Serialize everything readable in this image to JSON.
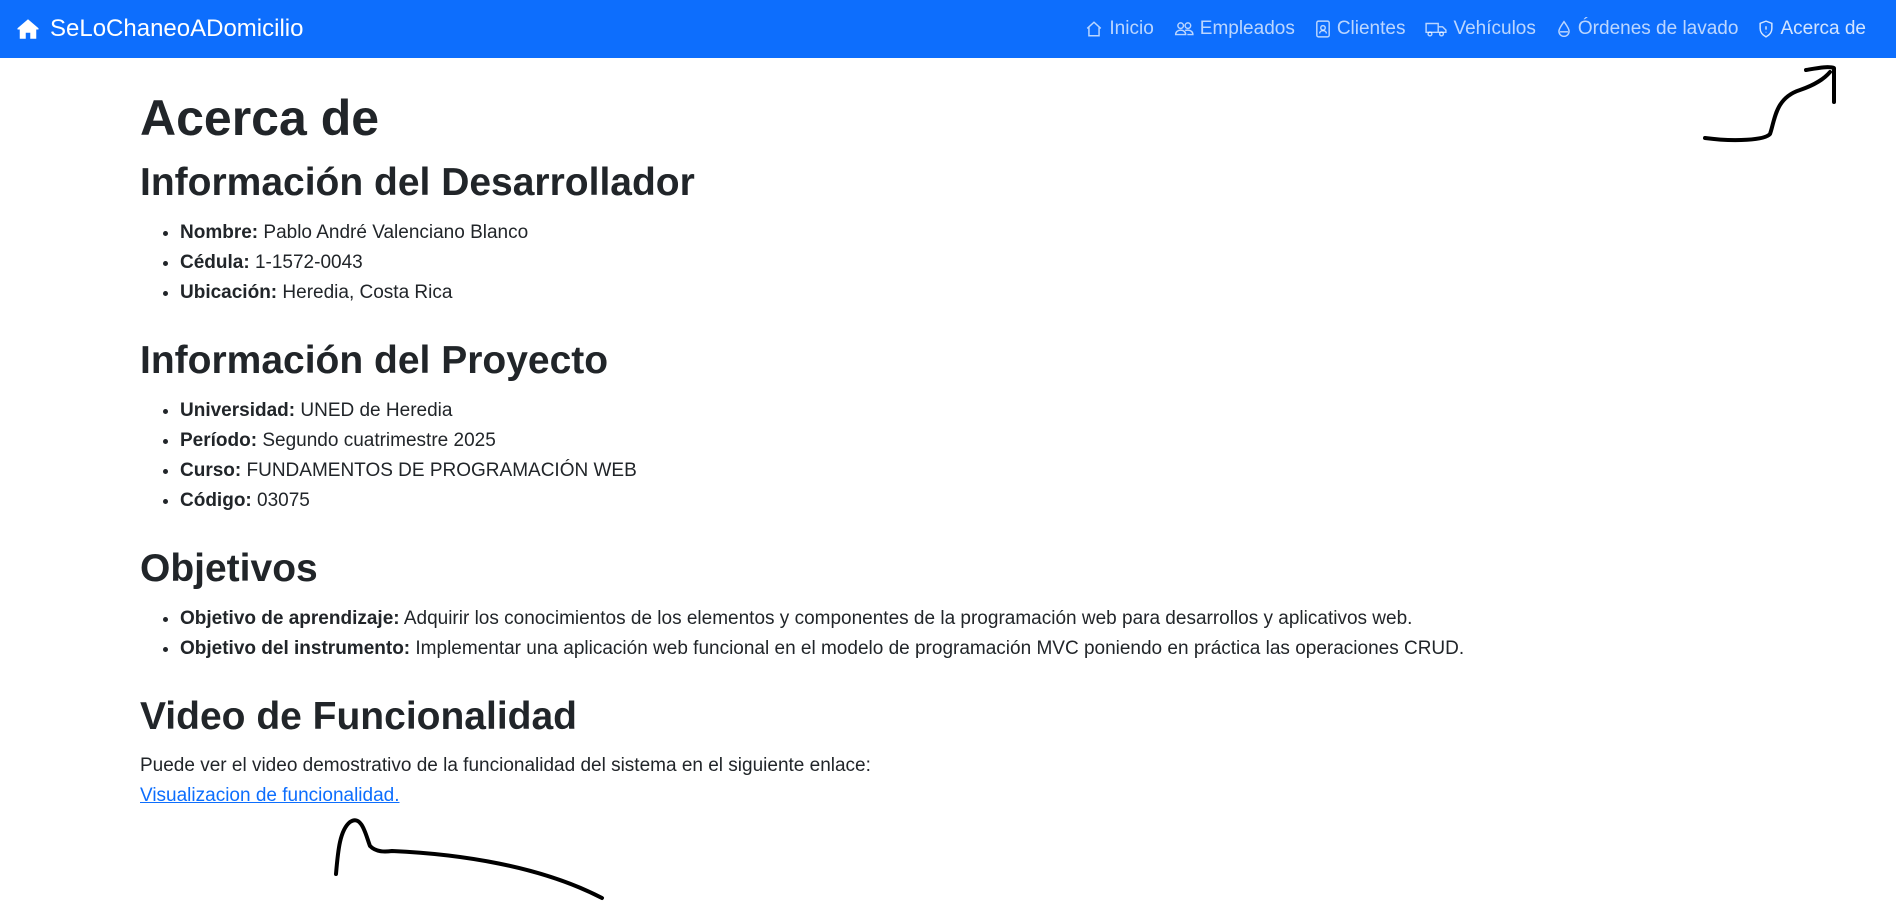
{
  "navbar": {
    "brand": "SeLoChaneoADomicilio",
    "links": [
      {
        "label": "Inicio",
        "icon": "house-icon"
      },
      {
        "label": "Empleados",
        "icon": "people-icon"
      },
      {
        "label": "Clientes",
        "icon": "person-badge-icon"
      },
      {
        "label": "Vehículos",
        "icon": "truck-icon"
      },
      {
        "label": "Órdenes de lavado",
        "icon": "droplet-icon"
      },
      {
        "label": "Acerca de",
        "icon": "shield-icon"
      }
    ],
    "bg_color": "#0d6efd"
  },
  "page": {
    "title": "Acerca de",
    "developer": {
      "heading": "Información del Desarrollador",
      "items": [
        {
          "key": "Nombre:",
          "value": " Pablo André Valenciano Blanco"
        },
        {
          "key": "Cédula:",
          "value": " 1-1572-0043"
        },
        {
          "key": "Ubicación:",
          "value": " Heredia, Costa Rica"
        }
      ]
    },
    "project": {
      "heading": "Información del Proyecto",
      "items": [
        {
          "key": "Universidad:",
          "value": " UNED de Heredia"
        },
        {
          "key": "Período:",
          "value": " Segundo cuatrimestre 2025"
        },
        {
          "key": "Curso:",
          "value": " FUNDAMENTOS DE PROGRAMACIÓN WEB"
        },
        {
          "key": "Código:",
          "value": " 03075"
        }
      ]
    },
    "objectives": {
      "heading": "Objetivos",
      "items": [
        {
          "key": "Objetivo de aprendizaje:",
          "value": " Adquirir los conocimientos de los elementos y componentes de la programación web para desarrollos y aplicativos web."
        },
        {
          "key": "Objetivo del instrumento:",
          "value": " Implementar una aplicación web funcional en el modelo de programación MVC poniendo en práctica las operaciones CRUD."
        }
      ]
    },
    "video": {
      "heading": "Video de Funcionalidad",
      "text": "Puede ver el video demostrativo de la funcionalidad del sistema en el siguiente enlace:",
      "link": "Visualizacion de funcionalidad."
    }
  }
}
